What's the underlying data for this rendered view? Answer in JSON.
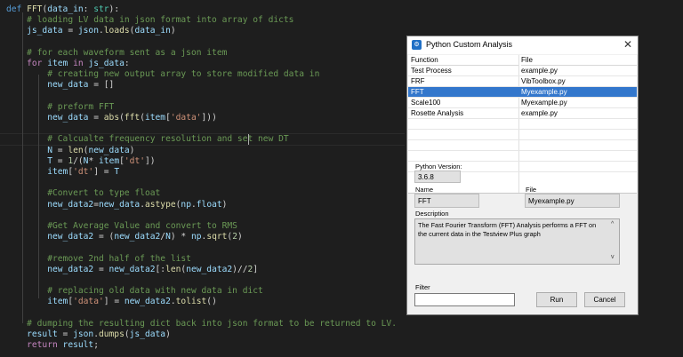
{
  "editor": {
    "lines": [
      "def FFT(data_in: str):",
      "    # loading LV data in json format into array of dicts",
      "    js_data = json.loads(data_in)",
      "",
      "    # for each waveform sent as a json item",
      "    for item in js_data:",
      "        # creating new output array to store modified data in",
      "        new_data = []",
      "",
      "        # preform FFT",
      "        new_data = abs(fft(item['data']))",
      "",
      "        # Calcualte frequency resolution and set new DT",
      "        N = len(new_data)",
      "        T = 1/(N* item['dt'])",
      "        item['dt'] = T",
      "",
      "        #Convert to type float",
      "        new_data2=new_data.astype(np.float)",
      "",
      "        #Get Average Value and convert to RMS",
      "        new_data2 = (new_data2/N) * np.sqrt(2)",
      "",
      "        #remove 2nd half of the list",
      "        new_data2 = new_data2[:len(new_data2)//2]",
      "",
      "        # replacing old data with new data in dict",
      "        item['data'] = new_data2.tolist()",
      "",
      "    # dumping the resulting dict back into json format to be returned to LV.",
      "    result = json.dumps(js_data)",
      "    return result;"
    ]
  },
  "dialog": {
    "title": "Python Custom Analysis",
    "close_icon": "close-icon",
    "table": {
      "headers": [
        "Function",
        "File"
      ],
      "rows": [
        {
          "function": "Test Process",
          "file": "example.py"
        },
        {
          "function": "FRF",
          "file": "VibToolbox.py"
        },
        {
          "function": "FFT",
          "file": "Myexample.py"
        },
        {
          "function": "Scale100",
          "file": "Myexample.py"
        },
        {
          "function": "Rosette Analysis",
          "file": "example.py"
        }
      ],
      "selected_index": 2
    },
    "python_version_label": "Python Version:",
    "python_version": "3.6.8",
    "name_label": "Name",
    "name_value": "FFT",
    "file_label": "File",
    "file_value": "Myexample.py",
    "description_label": "Description",
    "description": "The Fast Fourier Transform (FFT) Analysis performs a FFT on the current data in the Testview Plus graph",
    "filter_label": "Filter",
    "filter_value": "",
    "run_label": "Run",
    "cancel_label": "Cancel"
  },
  "colors": {
    "editor_bg": "#1e1e1e",
    "selection": "#3377cc",
    "keyword": "#569cd6",
    "comment": "#6a9955",
    "string": "#ce9178"
  }
}
